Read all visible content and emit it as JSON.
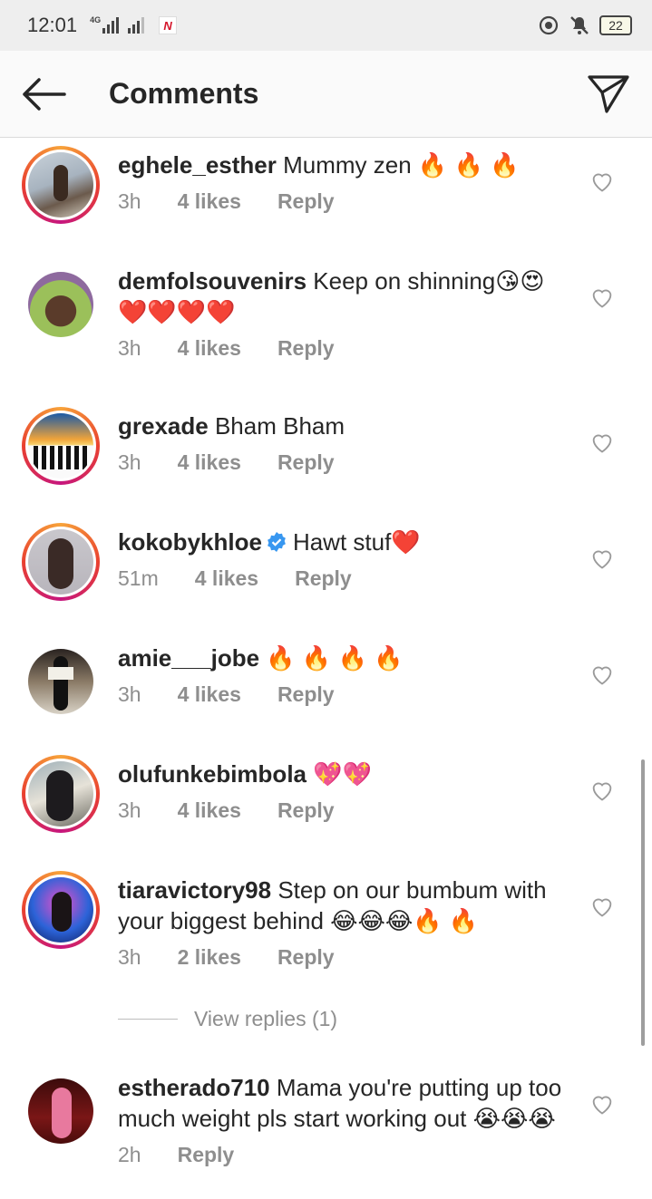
{
  "status_bar": {
    "time": "12:01",
    "network": "4G",
    "battery": "22"
  },
  "header": {
    "title": "Comments",
    "back_icon": "arrow-left-icon",
    "share_icon": "direct-send-icon"
  },
  "comments": [
    {
      "username": "eghele_esther",
      "text": "Mummy zen 🔥 🔥 🔥",
      "time": "3h",
      "likes": "4 likes",
      "reply": "Reply",
      "story_ring": true,
      "verified": false
    },
    {
      "username": "demfolsouvenirs",
      "text": "Keep on shinning😘😍❤️❤️❤️❤️",
      "time": "3h",
      "likes": "4 likes",
      "reply": "Reply",
      "story_ring": false,
      "verified": false
    },
    {
      "username": "grexade",
      "text": "Bham Bham",
      "time": "3h",
      "likes": "4 likes",
      "reply": "Reply",
      "story_ring": true,
      "verified": false
    },
    {
      "username": "kokobykhloe",
      "text": "Hawt stuf❤️",
      "time": "51m",
      "likes": "4 likes",
      "reply": "Reply",
      "story_ring": true,
      "verified": true
    },
    {
      "username": "amie___jobe",
      "text": "🔥 🔥 🔥 🔥",
      "time": "3h",
      "likes": "4 likes",
      "reply": "Reply",
      "story_ring": false,
      "verified": false
    },
    {
      "username": "olufunkebimbola",
      "text": "💖💖",
      "time": "3h",
      "likes": "4 likes",
      "reply": "Reply",
      "story_ring": true,
      "verified": false
    },
    {
      "username": "tiaravictory98",
      "text": "Step on our bumbum with your biggest behind 😂😂😂🔥 🔥",
      "time": "3h",
      "likes": "2 likes",
      "reply": "Reply",
      "story_ring": true,
      "verified": false
    },
    {
      "username": "estherado710",
      "text": "Mama you're putting up too much weight pls start working out 😭😭😭",
      "time": "2h",
      "likes": "",
      "reply": "Reply",
      "story_ring": false,
      "verified": false
    }
  ],
  "view_replies": "View replies (1)",
  "colors": {
    "text": "#262626",
    "meta": "#8e8e8e",
    "verified": "#3897f0",
    "ring_start": "#f7a33a",
    "ring_end": "#c6167e"
  }
}
